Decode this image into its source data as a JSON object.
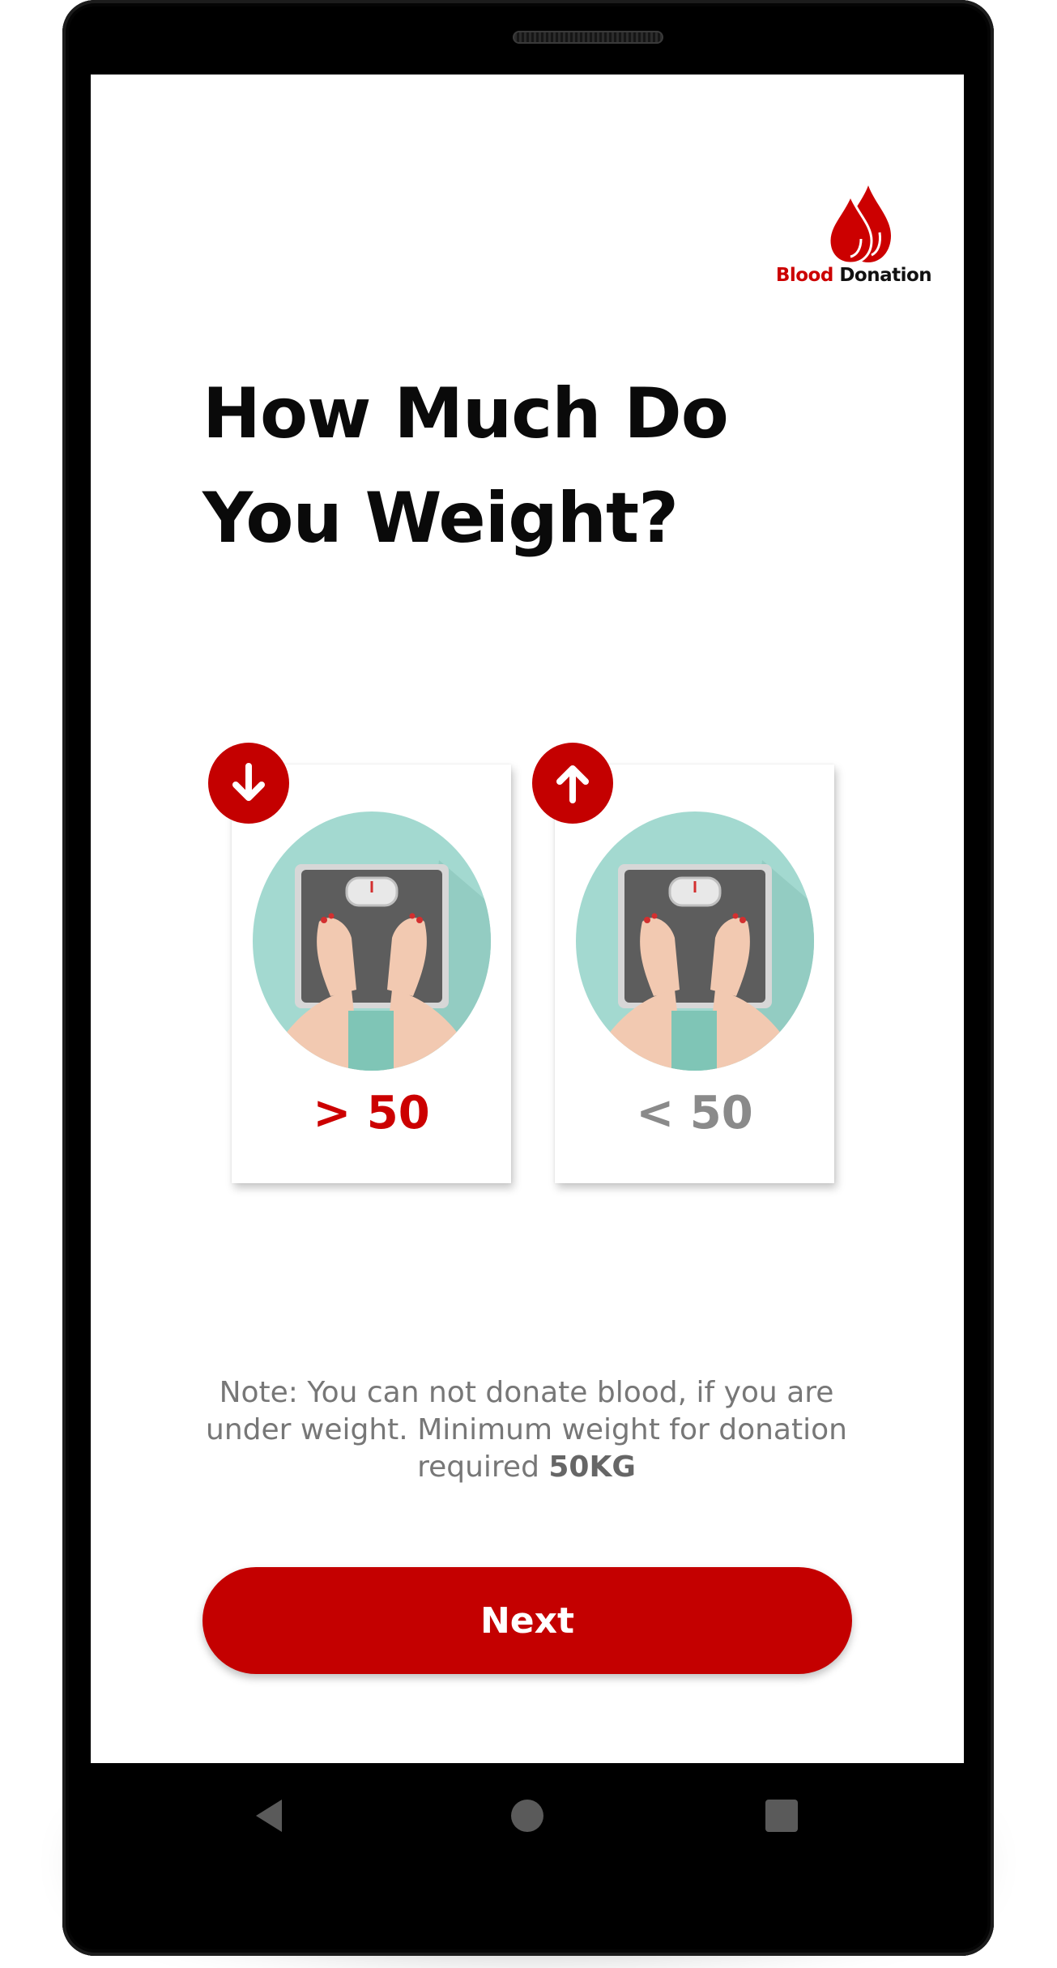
{
  "app": {
    "logo_text_red": "Blood",
    "logo_text_dark": "Donation"
  },
  "page": {
    "title_line1": "How Much Do",
    "title_line2": "You Weight?"
  },
  "options": [
    {
      "label": "> 50",
      "badge_icon": "arrow-down-icon",
      "selected": true
    },
    {
      "label": "< 50",
      "badge_icon": "arrow-up-icon",
      "selected": false
    }
  ],
  "note": {
    "text": "Note: You can not donate blood, if you are under weight. Minimum weight for donation required ",
    "emphasis": "50KG"
  },
  "actions": {
    "next_label": "Next"
  },
  "system_nav": [
    "back-icon",
    "home-icon",
    "recents-icon"
  ],
  "colors": {
    "accent": "#c40000",
    "disabled": "#8a8a8a",
    "illustration_bg": "#a3d9d0"
  }
}
